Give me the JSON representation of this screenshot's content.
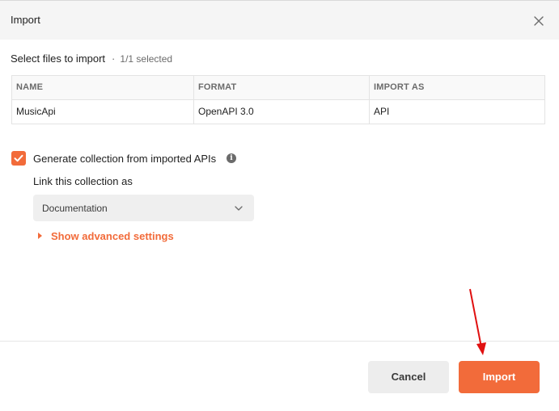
{
  "dialog": {
    "title": "Import",
    "close_icon": "close-icon"
  },
  "selection": {
    "heading": "Select files to import",
    "separator": "·",
    "count_text": "1/1 selected"
  },
  "table": {
    "columns": [
      "NAME",
      "FORMAT",
      "IMPORT AS"
    ],
    "rows": [
      [
        "MusicApi",
        "OpenAPI 3.0",
        "API"
      ]
    ]
  },
  "options": {
    "generate_collection": {
      "checked": true,
      "label": "Generate collection from imported APIs",
      "info_icon": "info-icon"
    },
    "link_label": "Link this collection as",
    "link_select": {
      "selected": "Documentation",
      "icon": "chevron-down-icon"
    },
    "advanced_label": "Show advanced settings"
  },
  "footer": {
    "cancel_label": "Cancel",
    "import_label": "Import"
  },
  "colors": {
    "accent": "#f26b3a",
    "annotation_arrow": "#e01010"
  }
}
